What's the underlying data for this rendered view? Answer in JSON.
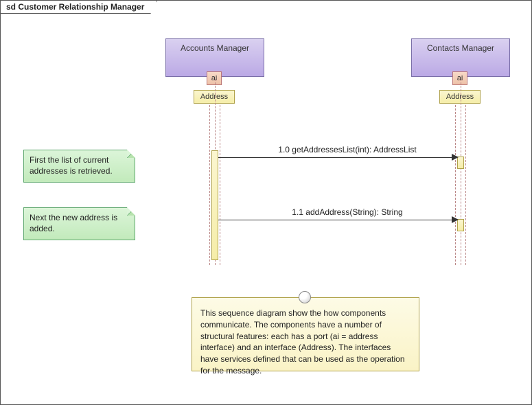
{
  "frame": {
    "title": "sd Customer Relationship Manager"
  },
  "lifelines": {
    "accounts": {
      "name": "Accounts Manager",
      "port": "ai",
      "iface": "Address"
    },
    "contacts": {
      "name": "Contacts Manager",
      "port": "ai",
      "iface": "Address"
    }
  },
  "messages": {
    "m1": {
      "label": "1.0 getAddressesList(int): AddressList"
    },
    "m2": {
      "label": "1.1 addAddress(String): String"
    }
  },
  "notes": {
    "n1": "First the list of current addresses is retrieved.",
    "n2": "Next the new address is added.",
    "info": "This sequence diagram show the how components communicate. The components have a number of structural features: each has a port (ai = address interface) and an interface (Address). The interfaces have services defined that can be used as the operation for the message."
  }
}
